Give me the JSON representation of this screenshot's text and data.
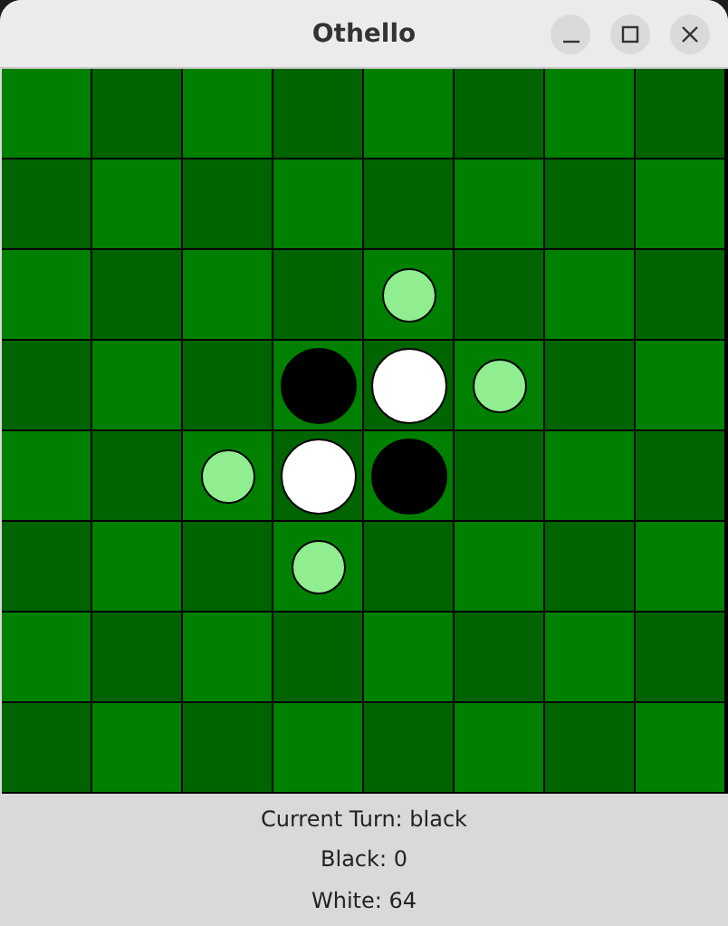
{
  "window": {
    "title": "Othello"
  },
  "board": [
    [
      {
        "kind": "empty"
      },
      {
        "kind": "empty"
      },
      {
        "kind": "empty"
      },
      {
        "kind": "empty"
      },
      {
        "kind": "empty"
      },
      {
        "kind": "empty"
      },
      {
        "kind": "empty"
      },
      {
        "kind": "empty"
      }
    ],
    [
      {
        "kind": "empty"
      },
      {
        "kind": "empty"
      },
      {
        "kind": "empty"
      },
      {
        "kind": "empty"
      },
      {
        "kind": "empty"
      },
      {
        "kind": "empty"
      },
      {
        "kind": "empty"
      },
      {
        "kind": "empty"
      }
    ],
    [
      {
        "kind": "empty"
      },
      {
        "kind": "empty"
      },
      {
        "kind": "empty"
      },
      {
        "kind": "empty"
      },
      {
        "kind": "hint"
      },
      {
        "kind": "empty"
      },
      {
        "kind": "empty"
      },
      {
        "kind": "empty"
      }
    ],
    [
      {
        "kind": "empty"
      },
      {
        "kind": "empty"
      },
      {
        "kind": "empty"
      },
      {
        "kind": "black"
      },
      {
        "kind": "white"
      },
      {
        "kind": "hint"
      },
      {
        "kind": "empty"
      },
      {
        "kind": "empty"
      }
    ],
    [
      {
        "kind": "empty"
      },
      {
        "kind": "empty"
      },
      {
        "kind": "hint"
      },
      {
        "kind": "white"
      },
      {
        "kind": "black"
      },
      {
        "kind": "empty"
      },
      {
        "kind": "empty"
      },
      {
        "kind": "empty"
      }
    ],
    [
      {
        "kind": "empty"
      },
      {
        "kind": "empty"
      },
      {
        "kind": "empty"
      },
      {
        "kind": "hint"
      },
      {
        "kind": "empty"
      },
      {
        "kind": "empty"
      },
      {
        "kind": "empty"
      },
      {
        "kind": "empty"
      }
    ],
    [
      {
        "kind": "empty"
      },
      {
        "kind": "empty"
      },
      {
        "kind": "empty"
      },
      {
        "kind": "empty"
      },
      {
        "kind": "empty"
      },
      {
        "kind": "empty"
      },
      {
        "kind": "empty"
      },
      {
        "kind": "empty"
      }
    ],
    [
      {
        "kind": "empty"
      },
      {
        "kind": "empty"
      },
      {
        "kind": "empty"
      },
      {
        "kind": "empty"
      },
      {
        "kind": "empty"
      },
      {
        "kind": "empty"
      },
      {
        "kind": "empty"
      },
      {
        "kind": "empty"
      }
    ]
  ],
  "status": {
    "turn": "Current Turn: black",
    "black_count": "Black: 0",
    "white_count": "White: 64"
  }
}
